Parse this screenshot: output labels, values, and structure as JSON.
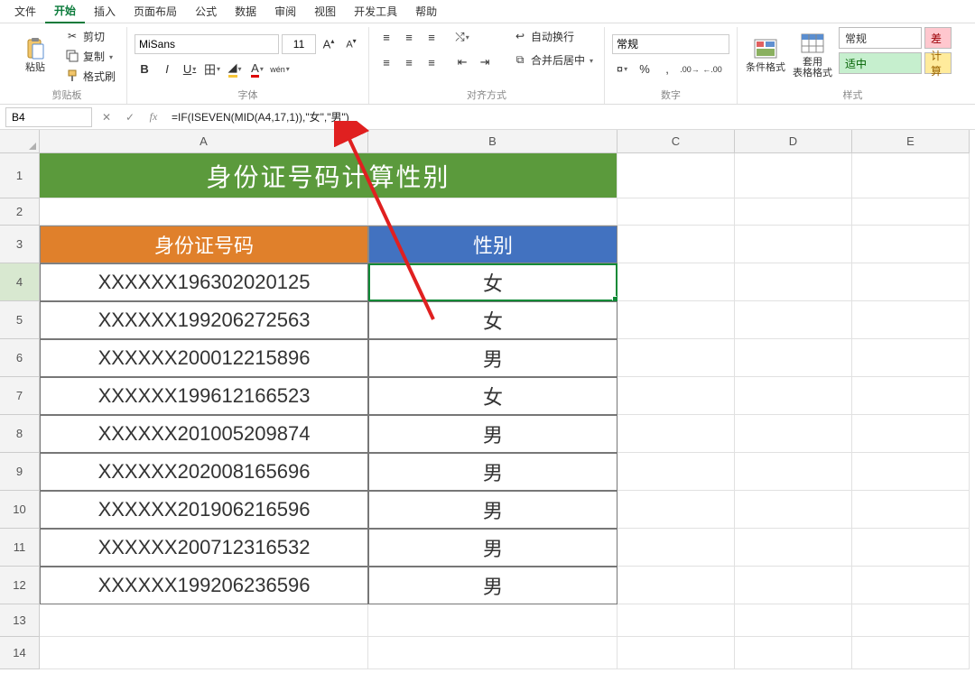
{
  "menu": {
    "items": [
      "文件",
      "开始",
      "插入",
      "页面布局",
      "公式",
      "数据",
      "审阅",
      "视图",
      "开发工具",
      "帮助"
    ],
    "active_index": 1
  },
  "ribbon": {
    "clipboard": {
      "paste": "粘贴",
      "cut": "剪切",
      "copy": "复制",
      "fmtpainter": "格式刷",
      "group": "剪贴板"
    },
    "font": {
      "name": "MiSans",
      "size": "11",
      "bold": "B",
      "italic": "I",
      "underline": "U",
      "tian": "田",
      "wen": "wén",
      "group": "字体"
    },
    "align": {
      "wrap": "自动换行",
      "merge": "合并后居中",
      "group": "对齐方式"
    },
    "number": {
      "format": "常规",
      "group": "数字"
    },
    "styles": {
      "condfmt": "条件格式",
      "tablefmt": "套用\n表格格式",
      "normal": "常规",
      "bad": "差",
      "good": "适中",
      "calc": "计算",
      "group": "样式"
    }
  },
  "formula_bar": {
    "name": "B4",
    "formula": "=IF(ISEVEN(MID(A4,17,1)),\"女\",\"男\")"
  },
  "sheet": {
    "columns": [
      "A",
      "B",
      "C",
      "D",
      "E"
    ],
    "title": "身份证号码计算性别",
    "headers": {
      "a": "身份证号码",
      "b": "性别"
    },
    "rows": [
      {
        "id": "XXXXXX196302020125",
        "gender": "女"
      },
      {
        "id": "XXXXXX199206272563",
        "gender": "女"
      },
      {
        "id": "XXXXXX200012215896",
        "gender": "男"
      },
      {
        "id": "XXXXXX199612166523",
        "gender": "女"
      },
      {
        "id": "XXXXXX201005209874",
        "gender": "男"
      },
      {
        "id": "XXXXXX202008165696",
        "gender": "男"
      },
      {
        "id": "XXXXXX201906216596",
        "gender": "男"
      },
      {
        "id": "XXXXXX200712316532",
        "gender": "男"
      },
      {
        "id": "XXXXXX199206236596",
        "gender": "男"
      }
    ],
    "selected_cell": "B4"
  },
  "chart_data": {
    "type": "table",
    "title": "身份证号码计算性别",
    "columns": [
      "身份证号码",
      "性别"
    ],
    "rows": [
      [
        "XXXXXX196302020125",
        "女"
      ],
      [
        "XXXXXX199206272563",
        "女"
      ],
      [
        "XXXXXX200012215896",
        "男"
      ],
      [
        "XXXXXX199612166523",
        "女"
      ],
      [
        "XXXXXX201005209874",
        "男"
      ],
      [
        "XXXXXX202008165696",
        "男"
      ],
      [
        "XXXXXX201906216596",
        "男"
      ],
      [
        "XXXXXX200712316532",
        "男"
      ],
      [
        "XXXXXX199206236596",
        "男"
      ]
    ]
  }
}
